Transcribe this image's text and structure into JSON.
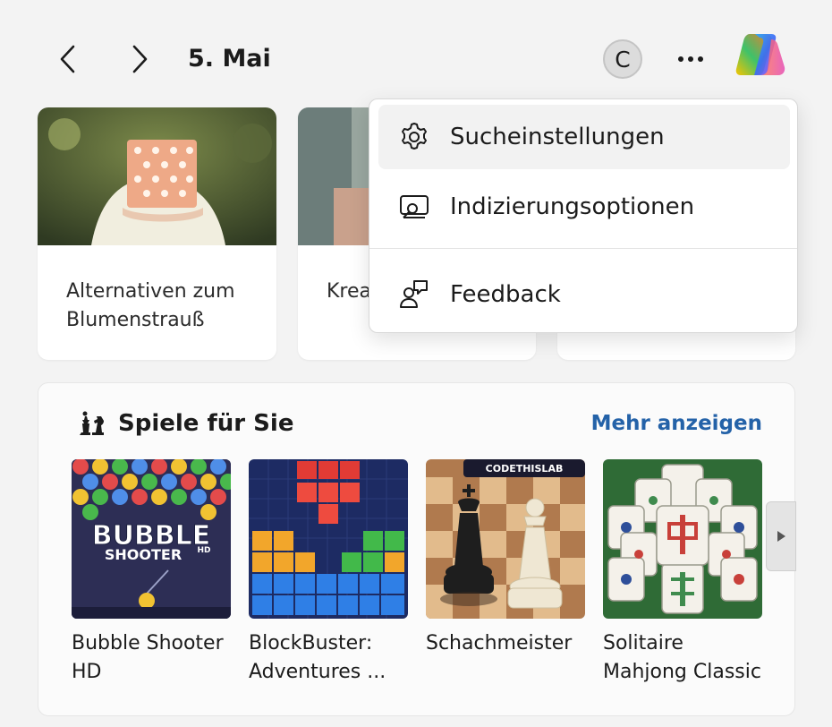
{
  "header": {
    "date": "5. Mai",
    "avatar_letter": "C",
    "icons": {
      "back": "chevron-left-icon",
      "forward": "chevron-right-icon",
      "more": "more-horizontal-icon",
      "copilot": "copilot-logo"
    }
  },
  "cards": [
    {
      "text": "Alternativen zum Blumenstrauß"
    },
    {
      "text": "Krea… Gesc…"
    },
    {
      "text": ""
    }
  ],
  "menu": {
    "items": [
      {
        "label": "Sucheinstellungen",
        "icon": "gear-icon",
        "highlighted": true
      },
      {
        "label": "Indizierungsoptionen",
        "icon": "indexing-icon",
        "highlighted": false
      },
      {
        "label": "Feedback",
        "icon": "feedback-icon",
        "highlighted": false
      }
    ]
  },
  "games": {
    "title": "Spiele für Sie",
    "more_label": "Mehr anzeigen",
    "icon": "chess-pieces-icon",
    "items": [
      {
        "label": "Bubble Shooter HD",
        "logo_line1": "BUBBLE",
        "logo_line2": "SHOOTER",
        "logo_badge": "HD"
      },
      {
        "label": "BlockBuster: Adventures ..."
      },
      {
        "label": "Schachmeister",
        "banner": "CODETHISLAB"
      },
      {
        "label": "Solitaire Mahjong Classic"
      }
    ]
  },
  "colors": {
    "accent_link": "#2462a8",
    "background": "#f3f3f3",
    "menu_highlight": "#f2f2f2"
  }
}
